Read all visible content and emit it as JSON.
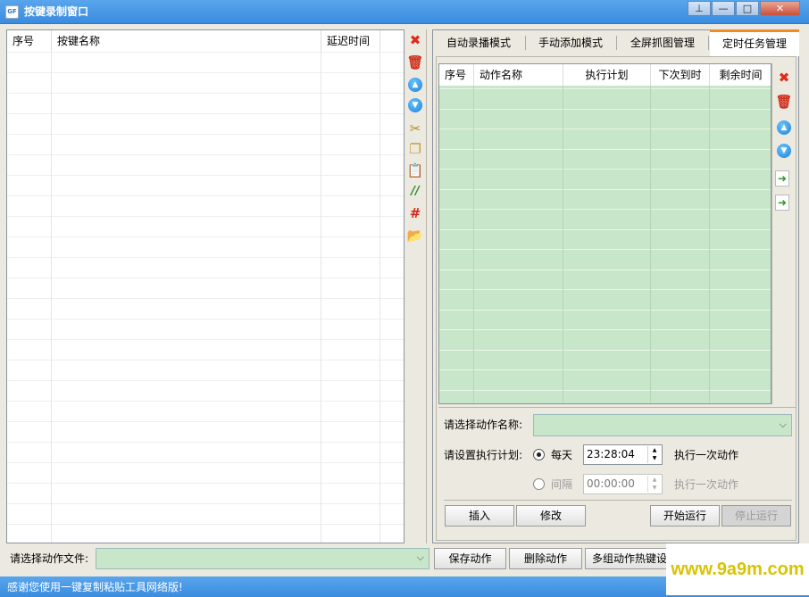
{
  "window": {
    "title": "按键录制窗口",
    "app_icon_text": "GF",
    "controls": {
      "pin": "⊥",
      "minimize": "—",
      "maximize": "□",
      "close": "✕"
    }
  },
  "left_table": {
    "columns": [
      "序号",
      "按键名称",
      "延迟时间"
    ],
    "rows": []
  },
  "left_toolbar": [
    {
      "name": "delete-x-icon",
      "glyph": "✖",
      "color": "#e02a1a"
    },
    {
      "name": "trash-icon",
      "glyph": "🗑",
      "color": "#d0301c"
    },
    {
      "name": "move-up-icon",
      "glyph": "▲",
      "color": "#1a7fd6"
    },
    {
      "name": "move-down-icon",
      "glyph": "▼",
      "color": "#1a7fd6"
    },
    {
      "name": "cut-icon",
      "glyph": "✂",
      "color": "#b08a2a"
    },
    {
      "name": "copy-icon",
      "glyph": "❐",
      "color": "#c39a3a"
    },
    {
      "name": "paste-icon",
      "glyph": "📋",
      "color": "#c39a3a"
    },
    {
      "name": "comment-icon",
      "glyph": "//",
      "color": "#2a8a2a"
    },
    {
      "name": "hash-icon",
      "glyph": "#",
      "color": "#d8281a"
    },
    {
      "name": "folder-open-icon",
      "glyph": "📂",
      "color": "#e0b040"
    }
  ],
  "left_bottom": {
    "file_label": "请选择动作文件:",
    "file_value": ""
  },
  "tabs": [
    "自动录播模式",
    "手动添加模式",
    "全屏抓图管理",
    "定时任务管理"
  ],
  "active_tab": 3,
  "task_table": {
    "columns": [
      "序号",
      "动作名称",
      "执行计划",
      "下次到时",
      "剩余时间"
    ],
    "rows": []
  },
  "right_toolbar": [
    {
      "name": "delete-x-icon",
      "glyph": "✖",
      "color": "#e02a1a"
    },
    {
      "name": "trash-icon",
      "glyph": "🗑",
      "color": "#d0301c"
    },
    {
      "name": "move-up-icon",
      "glyph": "▲",
      "color": "#1a7fd6"
    },
    {
      "name": "move-down-icon",
      "glyph": "▼",
      "color": "#1a7fd6"
    },
    {
      "name": "import-icon",
      "glyph": "➜",
      "color": "#2a9a2a"
    },
    {
      "name": "export-icon",
      "glyph": "➜",
      "color": "#2a9a2a"
    }
  ],
  "schedule": {
    "action_label": "请选择动作名称:",
    "action_value": "",
    "plan_label": "请设置执行计划:",
    "daily_label": "每天",
    "daily_time": "23:28:04",
    "daily_suffix": "执行一次动作",
    "interval_label": "间隔",
    "interval_time": "00:00:00",
    "interval_suffix": "执行一次动作"
  },
  "right_buttons": {
    "insert": "插入",
    "modify": "修改",
    "start": "开始运行",
    "stop": "停止运行"
  },
  "bottom_buttons": {
    "save": "保存动作",
    "delete": "删除动作",
    "multi": "多组动作热键设"
  },
  "status": {
    "text": "感谢您使用一键复制粘贴工具网络版!"
  },
  "watermark": "www.9a9m.com",
  "colors": {
    "grid_fill": "#c8e6c9",
    "active_tab_accent": "#f08a24",
    "title_blue": "#3a8ce0"
  }
}
